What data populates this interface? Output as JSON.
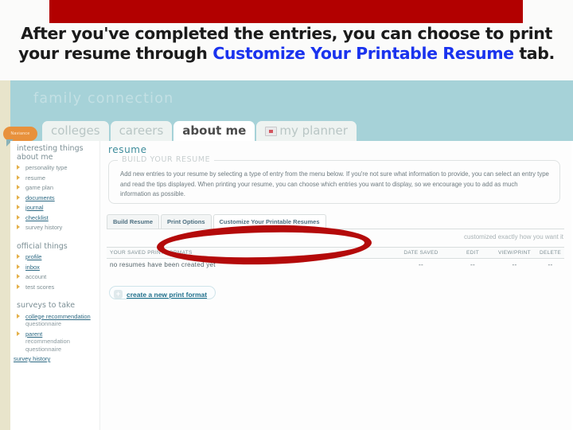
{
  "slide": {
    "title_before": "After you've completed the entries, you can choose to print your resume through ",
    "title_highlight": "Customize Your Printable Resume",
    "title_after": " tab.",
    "accent_red": "#b20000",
    "highlight_blue": "#1a33ee",
    "annotation_color": "#b40a0a"
  },
  "app": {
    "brand": "family connection",
    "badge_label": "Naviance",
    "tabs": [
      {
        "label": "colleges",
        "active": false,
        "icon": ""
      },
      {
        "label": "careers",
        "active": false,
        "icon": ""
      },
      {
        "label": "about me",
        "active": true,
        "icon": ""
      },
      {
        "label": "my planner",
        "active": false,
        "icon": "calendar-icon"
      }
    ]
  },
  "sidebar": {
    "sections": [
      {
        "heading": "interesting things about me",
        "items": [
          {
            "label": "personality type",
            "link": false
          },
          {
            "label": "resume",
            "link": false
          },
          {
            "label": "game plan",
            "link": false
          },
          {
            "label": "documents",
            "link": true
          },
          {
            "label": "journal",
            "link": true
          },
          {
            "label": "checklist",
            "link": true
          },
          {
            "label": "survey history",
            "link": false
          }
        ]
      },
      {
        "heading": "official things",
        "items": [
          {
            "label": "profile",
            "link": true
          },
          {
            "label": "inbox",
            "link": true
          },
          {
            "label": "account",
            "link": false
          },
          {
            "label": "test scores",
            "link": false
          }
        ]
      },
      {
        "heading": "surveys to take",
        "items": [
          {
            "label": "college recommendation",
            "sub": "questionnaire",
            "link": true
          },
          {
            "label": "parent",
            "sub": "recommendation questionnaire",
            "link": true
          }
        ]
      }
    ],
    "footer_link": "survey history"
  },
  "main": {
    "page_title": "resume",
    "fieldset_legend": "BUILD YOUR RESUME",
    "fieldset_text": "Add new entries to your resume by selecting a type of entry from the menu below. If you're not sure what information to provide, you can select an entry type and read the tips displayed. When printing your resume, you can choose which entries you want to display, so we encourage you to add as much information as possible.",
    "subtabs": [
      {
        "label": "Build Resume",
        "active": false
      },
      {
        "label": "Print Options",
        "active": false
      },
      {
        "label": "Customize Your Printable Resumes",
        "active": true
      }
    ],
    "tagline": "customized exactly how you want it",
    "table": {
      "columns": [
        "YOUR SAVED PRINT FORMATS",
        "DATE SAVED",
        "EDIT",
        "VIEW/PRINT",
        "DELETE"
      ],
      "rows": [
        [
          "no resumes have been created yet",
          "--",
          "--",
          "--",
          "--"
        ]
      ]
    },
    "cta": {
      "plus": "+",
      "label": "create a new print format"
    }
  }
}
